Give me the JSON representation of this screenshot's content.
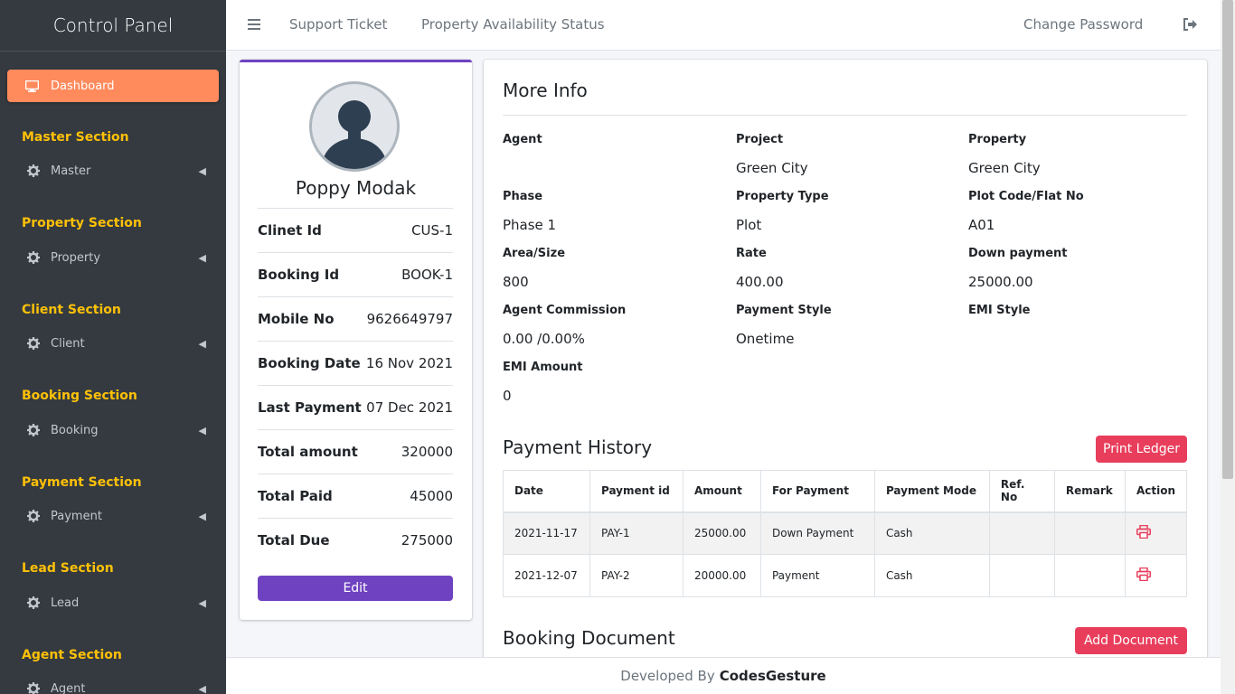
{
  "brand": "Control Panel",
  "sidebar": {
    "dashboard": "Dashboard",
    "sections": [
      {
        "header": "Master Section",
        "item": "Master"
      },
      {
        "header": "Property Section",
        "item": "Property"
      },
      {
        "header": "Client Section",
        "item": "Client"
      },
      {
        "header": "Booking Section",
        "item": "Booking"
      },
      {
        "header": "Payment Section",
        "item": "Payment"
      },
      {
        "header": "Lead Section",
        "item": "Lead"
      },
      {
        "header": "Agent Section",
        "item": "Agent"
      }
    ]
  },
  "topbar": {
    "support": "Support Ticket",
    "availability": "Property Availability Status",
    "change_password": "Change Password"
  },
  "profile": {
    "name": "Poppy Modak",
    "rows": [
      {
        "label": "Clinet Id",
        "value": "CUS-1"
      },
      {
        "label": "Booking Id",
        "value": "BOOK-1"
      },
      {
        "label": "Mobile No",
        "value": "9626649797"
      },
      {
        "label": "Booking Date",
        "value": "16 Nov 2021"
      },
      {
        "label": "Last Payment",
        "value": "07 Dec 2021"
      },
      {
        "label": "Total amount",
        "value": "320000"
      },
      {
        "label": "Total Paid",
        "value": "45000"
      },
      {
        "label": "Total Due",
        "value": "275000"
      }
    ],
    "edit": "Edit"
  },
  "more_info": {
    "title": "More Info",
    "fields": [
      {
        "label": "Agent",
        "value": ""
      },
      {
        "label": "Project",
        "value": "Green City"
      },
      {
        "label": "Property",
        "value": "Green City"
      },
      {
        "label": "Phase",
        "value": "Phase 1"
      },
      {
        "label": "Property Type",
        "value": "Plot"
      },
      {
        "label": "Plot Code/Flat No",
        "value": "A01"
      },
      {
        "label": "Area/Size",
        "value": "800"
      },
      {
        "label": "Rate",
        "value": "400.00"
      },
      {
        "label": "Down payment",
        "value": "25000.00"
      },
      {
        "label": "Agent Commission",
        "value": "0.00 /0.00%"
      },
      {
        "label": "Payment Style",
        "value": "Onetime"
      },
      {
        "label": "EMI Style",
        "value": ""
      },
      {
        "label": "EMI Amount",
        "value": "0"
      }
    ]
  },
  "payment_history": {
    "title": "Payment History",
    "print_button": "Print Ledger",
    "columns": [
      "Date",
      "Payment id",
      "Amount",
      "For Payment",
      "Payment Mode",
      "Ref. No",
      "Remark",
      "Action"
    ],
    "rows": [
      [
        "2021-11-17",
        "PAY-1",
        "25000.00",
        "Down Payment",
        "Cash",
        "",
        ""
      ],
      [
        "2021-12-07",
        "PAY-2",
        "20000.00",
        "Payment",
        "Cash",
        "",
        ""
      ]
    ]
  },
  "booking_document": {
    "title": "Booking Document",
    "add_button": "Add Document"
  },
  "footer": {
    "prefix": "Developed By",
    "company": "CodesGesture"
  },
  "colors": {
    "sidebar_bg": "#343a40",
    "section_header": "#ffc107",
    "dashboard_active": "#ff8a5c",
    "profile_accent": "#6f42c1",
    "danger_button": "#e83e5c"
  }
}
